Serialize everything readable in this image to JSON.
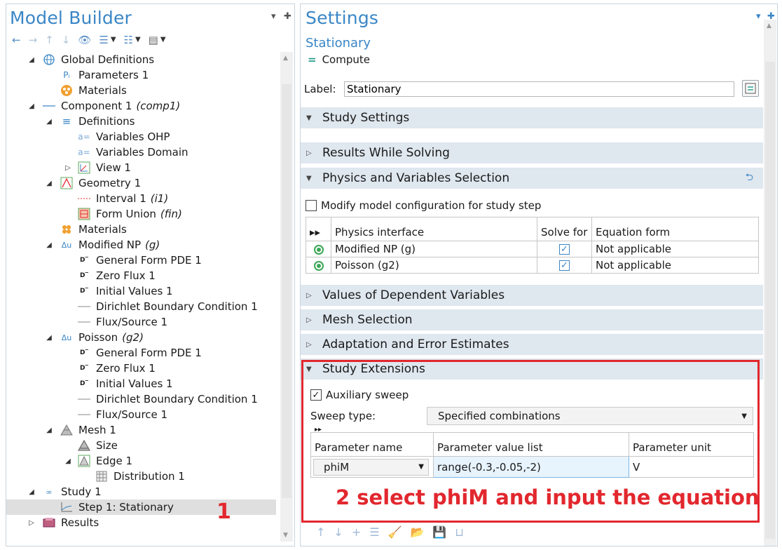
{
  "model_builder": {
    "title": "Model Builder",
    "tree": [
      {
        "label": "Global Definitions",
        "tag": "",
        "icon": "globe-icon"
      },
      {
        "label": "Parameters 1",
        "tag": "",
        "icon": "parameters-icon"
      },
      {
        "label": "Materials",
        "tag": "",
        "icon": "materials-icon"
      },
      {
        "label": "Component 1",
        "tag": "(comp1)",
        "icon": "component-icon"
      },
      {
        "label": "Definitions",
        "tag": "",
        "icon": "definitions-icon"
      },
      {
        "label": "Variables OHP",
        "tag": "",
        "icon": "variables-icon"
      },
      {
        "label": "Variables Domain",
        "tag": "",
        "icon": "variables-icon"
      },
      {
        "label": "View 1",
        "tag": "",
        "icon": "view-icon"
      },
      {
        "label": "Geometry 1",
        "tag": "",
        "icon": "geometry-icon"
      },
      {
        "label": "Interval 1",
        "tag": "(i1)",
        "icon": "interval-icon"
      },
      {
        "label": "Form Union",
        "tag": "(fin)",
        "icon": "form-union-icon"
      },
      {
        "label": "Materials",
        "tag": "",
        "icon": "materials-icon"
      },
      {
        "label": "Modified NP",
        "tag": "(g)",
        "icon": "physics-icon"
      },
      {
        "label": "General Form PDE 1",
        "tag": "",
        "icon": "pde-icon"
      },
      {
        "label": "Zero Flux 1",
        "tag": "",
        "icon": "pde-icon"
      },
      {
        "label": "Initial Values 1",
        "tag": "",
        "icon": "pde-icon"
      },
      {
        "label": "Dirichlet Boundary Condition 1",
        "tag": "",
        "icon": "boundary-icon"
      },
      {
        "label": "Flux/Source 1",
        "tag": "",
        "icon": "boundary-icon"
      },
      {
        "label": "Poisson",
        "tag": "(g2)",
        "icon": "physics-icon"
      },
      {
        "label": "General Form PDE 1",
        "tag": "",
        "icon": "pde-icon"
      },
      {
        "label": "Zero Flux 1",
        "tag": "",
        "icon": "pde-icon"
      },
      {
        "label": "Initial Values 1",
        "tag": "",
        "icon": "pde-icon"
      },
      {
        "label": "Dirichlet Boundary Condition 1",
        "tag": "",
        "icon": "boundary-icon"
      },
      {
        "label": "Flux/Source 1",
        "tag": "",
        "icon": "boundary-icon"
      },
      {
        "label": "Mesh 1",
        "tag": "",
        "icon": "mesh-icon"
      },
      {
        "label": "Size",
        "tag": "",
        "icon": "mesh-size-icon"
      },
      {
        "label": "Edge 1",
        "tag": "",
        "icon": "edge-icon"
      },
      {
        "label": "Distribution 1",
        "tag": "",
        "icon": "distribution-icon"
      },
      {
        "label": "Study 1",
        "tag": "",
        "icon": "study-icon"
      },
      {
        "label": "Step 1: Stationary",
        "tag": "",
        "icon": "stationary-icon"
      },
      {
        "label": "Results",
        "tag": "",
        "icon": "results-icon"
      }
    ],
    "annotation": "1"
  },
  "settings": {
    "title": "Settings",
    "subtitle": "Stationary",
    "compute_label": "Compute",
    "label_caption": "Label:",
    "label_value": "Stationary",
    "sections": {
      "study_settings": "Study Settings",
      "results_while_solving": "Results While Solving",
      "physics_selection": "Physics and Variables Selection",
      "dependent_variables": "Values of Dependent Variables",
      "mesh_selection": "Mesh Selection",
      "adaptation": "Adaptation and Error Estimates",
      "study_extensions": "Study Extensions"
    },
    "modify_config_label": "Modify model configuration for study step",
    "physics_table": {
      "headers": [
        "Physics interface",
        "Solve for",
        "Equation form"
      ],
      "rows": [
        {
          "interface": "Modified NP (g)",
          "form": "Not applicable"
        },
        {
          "interface": "Poisson (g2)",
          "form": "Not applicable"
        }
      ]
    },
    "auxiliary_sweep_label": "Auxiliary sweep",
    "sweep_type_label": "Sweep type:",
    "sweep_type_value": "Specified combinations",
    "sweep_table": {
      "headers": [
        "Parameter name",
        "Parameter value list",
        "Parameter unit"
      ],
      "rows": [
        {
          "name": "phiM",
          "values": "range(-0.3,-0.05,-2)",
          "unit": "V"
        }
      ]
    },
    "annotation": "2 select phiM and input the equation"
  }
}
